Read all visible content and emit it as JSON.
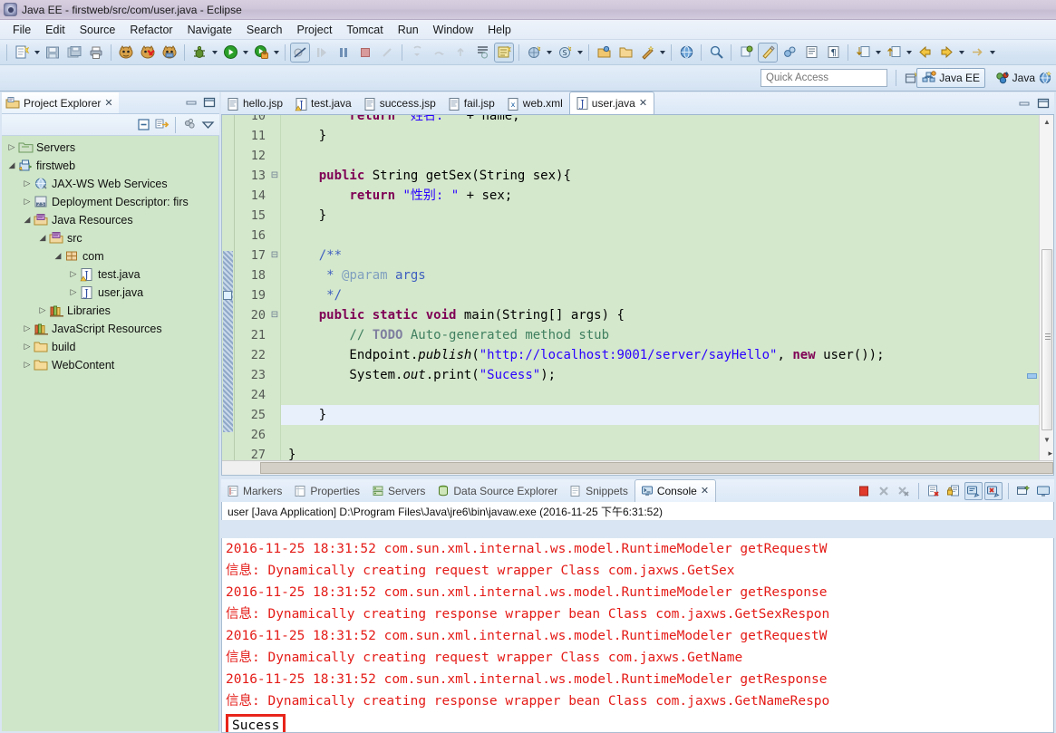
{
  "window": {
    "title": "Java EE - firstweb/src/com/user.java - Eclipse",
    "app_icon": "eclipse-icon"
  },
  "menubar": {
    "items": [
      "File",
      "Edit",
      "Source",
      "Refactor",
      "Navigate",
      "Search",
      "Project",
      "Tomcat",
      "Run",
      "Window",
      "Help"
    ]
  },
  "toolbar": {
    "quick_access_placeholder": "Quick Access",
    "perspectives": [
      {
        "label": "Java EE",
        "active": true
      },
      {
        "label": "Java",
        "active": false
      }
    ]
  },
  "project_explorer": {
    "title": "Project Explorer",
    "tree": [
      {
        "label": "Servers",
        "indent": 0,
        "arrow": "collapsed",
        "icon": "folder-server-icon"
      },
      {
        "label": "firstweb",
        "indent": 0,
        "arrow": "expanded",
        "icon": "web-project-icon"
      },
      {
        "label": "JAX-WS Web Services",
        "indent": 1,
        "arrow": "collapsed",
        "icon": "webservice-icon"
      },
      {
        "label": "Deployment Descriptor: firs",
        "indent": 1,
        "arrow": "collapsed",
        "icon": "deployment-descriptor-icon"
      },
      {
        "label": "Java Resources",
        "indent": 1,
        "arrow": "expanded",
        "icon": "java-resources-icon"
      },
      {
        "label": "src",
        "indent": 2,
        "arrow": "expanded",
        "icon": "source-folder-icon"
      },
      {
        "label": "com",
        "indent": 3,
        "arrow": "expanded",
        "icon": "package-icon"
      },
      {
        "label": "test.java",
        "indent": 4,
        "arrow": "collapsed",
        "icon": "java-file-warning-icon"
      },
      {
        "label": "user.java",
        "indent": 4,
        "arrow": "collapsed",
        "icon": "java-file-icon"
      },
      {
        "label": "Libraries",
        "indent": 2,
        "arrow": "collapsed",
        "icon": "libraries-icon"
      },
      {
        "label": "JavaScript Resources",
        "indent": 1,
        "arrow": "collapsed",
        "icon": "libraries-icon"
      },
      {
        "label": "build",
        "indent": 1,
        "arrow": "collapsed",
        "icon": "folder-icon"
      },
      {
        "label": "WebContent",
        "indent": 1,
        "arrow": "collapsed",
        "icon": "folder-icon"
      }
    ]
  },
  "editor": {
    "tabs": [
      {
        "label": "hello.jsp",
        "icon": "jsp-file-icon",
        "active": false
      },
      {
        "label": "test.java",
        "icon": "java-file-warning-icon",
        "active": false
      },
      {
        "label": "success.jsp",
        "icon": "jsp-file-icon",
        "active": false
      },
      {
        "label": "fail.jsp",
        "icon": "jsp-file-icon",
        "active": false
      },
      {
        "label": "web.xml",
        "icon": "xml-file-icon",
        "active": false
      },
      {
        "label": "user.java",
        "icon": "java-file-icon",
        "active": true
      }
    ],
    "first_line_number": 10,
    "lines": [
      {
        "n": 10,
        "fold": "",
        "clipped": true,
        "current": false,
        "tokens": [
          {
            "t": "        ",
            "c": ""
          },
          {
            "t": "return",
            "c": "kw"
          },
          {
            "t": " ",
            "c": ""
          },
          {
            "t": "\"姓名: \"",
            "c": "str"
          },
          {
            "t": " + name;",
            "c": ""
          }
        ]
      },
      {
        "n": 11,
        "fold": "",
        "current": false,
        "tokens": [
          {
            "t": "    }",
            "c": ""
          }
        ]
      },
      {
        "n": 12,
        "fold": "",
        "current": false,
        "tokens": [
          {
            "t": "",
            "c": ""
          }
        ]
      },
      {
        "n": 13,
        "fold": "-",
        "current": false,
        "tokens": [
          {
            "t": "    ",
            "c": ""
          },
          {
            "t": "public",
            "c": "kw"
          },
          {
            "t": " String getSex(String sex){",
            "c": ""
          }
        ]
      },
      {
        "n": 14,
        "fold": "",
        "current": false,
        "tokens": [
          {
            "t": "        ",
            "c": ""
          },
          {
            "t": "return",
            "c": "kw"
          },
          {
            "t": " ",
            "c": ""
          },
          {
            "t": "\"性别: \"",
            "c": "str"
          },
          {
            "t": " + sex;",
            "c": ""
          }
        ]
      },
      {
        "n": 15,
        "fold": "",
        "current": false,
        "tokens": [
          {
            "t": "    }",
            "c": ""
          }
        ]
      },
      {
        "n": 16,
        "fold": "",
        "current": false,
        "tokens": [
          {
            "t": "",
            "c": ""
          }
        ]
      },
      {
        "n": 17,
        "fold": "-",
        "current": false,
        "tokens": [
          {
            "t": "    /**",
            "c": "jdoc"
          }
        ]
      },
      {
        "n": 18,
        "fold": "",
        "current": false,
        "tokens": [
          {
            "t": "     * ",
            "c": "jdoc"
          },
          {
            "t": "@param",
            "c": "jdoc-tag"
          },
          {
            "t": " args",
            "c": "jdoc"
          }
        ]
      },
      {
        "n": 19,
        "fold": "",
        "current": false,
        "tokens": [
          {
            "t": "     */",
            "c": "jdoc"
          }
        ]
      },
      {
        "n": 20,
        "fold": "-",
        "current": false,
        "tokens": [
          {
            "t": "    ",
            "c": ""
          },
          {
            "t": "public static void",
            "c": "kw"
          },
          {
            "t": " main(String[] args) {",
            "c": ""
          }
        ]
      },
      {
        "n": 21,
        "fold": "",
        "current": false,
        "tokens": [
          {
            "t": "        ",
            "c": ""
          },
          {
            "t": "// ",
            "c": "cmt"
          },
          {
            "t": "TODO",
            "c": "cmt-task"
          },
          {
            "t": " Auto-generated method stub",
            "c": "cmt"
          }
        ]
      },
      {
        "n": 22,
        "fold": "",
        "current": false,
        "tokens": [
          {
            "t": "        Endpoint.",
            "c": ""
          },
          {
            "t": "publish",
            "c": "stat"
          },
          {
            "t": "(",
            "c": ""
          },
          {
            "t": "\"http://localhost:9001/server/sayHello\"",
            "c": "str"
          },
          {
            "t": ", ",
            "c": ""
          },
          {
            "t": "new",
            "c": "kw"
          },
          {
            "t": " user());",
            "c": ""
          }
        ]
      },
      {
        "n": 23,
        "fold": "",
        "current": false,
        "tokens": [
          {
            "t": "        System.",
            "c": ""
          },
          {
            "t": "out",
            "c": "stat"
          },
          {
            "t": ".print(",
            "c": ""
          },
          {
            "t": "\"Sucess\"",
            "c": "str"
          },
          {
            "t": ");",
            "c": ""
          }
        ]
      },
      {
        "n": 24,
        "fold": "",
        "current": false,
        "tokens": [
          {
            "t": "",
            "c": ""
          }
        ]
      },
      {
        "n": 25,
        "fold": "",
        "current": true,
        "tokens": [
          {
            "t": "    }",
            "c": ""
          }
        ]
      },
      {
        "n": 26,
        "fold": "",
        "current": false,
        "tokens": [
          {
            "t": "",
            "c": ""
          }
        ]
      },
      {
        "n": 27,
        "fold": "",
        "clipped_bottom": true,
        "current": false,
        "tokens": [
          {
            "t": "}",
            "c": ""
          }
        ]
      }
    ]
  },
  "console_panel": {
    "tabs": [
      {
        "label": "Markers",
        "icon": "markers-icon",
        "active": false
      },
      {
        "label": "Properties",
        "icon": "properties-icon",
        "active": false
      },
      {
        "label": "Servers",
        "icon": "servers-icon",
        "active": false
      },
      {
        "label": "Data Source Explorer",
        "icon": "data-source-icon",
        "active": false
      },
      {
        "label": "Snippets",
        "icon": "snippets-icon",
        "active": false
      },
      {
        "label": "Console",
        "icon": "console-icon",
        "active": true
      }
    ],
    "launch_info": "user [Java Application] D:\\Program Files\\Java\\jre6\\bin\\javaw.exe (2016-11-25 下午6:31:52)",
    "output_color": "#e41b17",
    "lines": [
      {
        "text": "2016-11-25 18:31:52 com.sun.xml.internal.ws.model.RuntimeModeler getRequestW",
        "kind": "error"
      },
      {
        "text": "信息: Dynamically creating request wrapper Class com.jaxws.GetSex",
        "kind": "error"
      },
      {
        "text": "2016-11-25 18:31:52 com.sun.xml.internal.ws.model.RuntimeModeler getResponse",
        "kind": "error"
      },
      {
        "text": "信息: Dynamically creating response wrapper bean Class com.jaxws.GetSexRespon",
        "kind": "error"
      },
      {
        "text": "2016-11-25 18:31:52 com.sun.xml.internal.ws.model.RuntimeModeler getRequestW",
        "kind": "error"
      },
      {
        "text": "信息: Dynamically creating request wrapper Class com.jaxws.GetName",
        "kind": "error"
      },
      {
        "text": "2016-11-25 18:31:52 com.sun.xml.internal.ws.model.RuntimeModeler getResponse",
        "kind": "error"
      },
      {
        "text": "信息: Dynamically creating response wrapper bean Class com.jaxws.GetNameRespo",
        "kind": "error"
      },
      {
        "text": "Sucess",
        "kind": "stdout-highlighted"
      }
    ],
    "highlight_border_color": "#e8251b"
  }
}
